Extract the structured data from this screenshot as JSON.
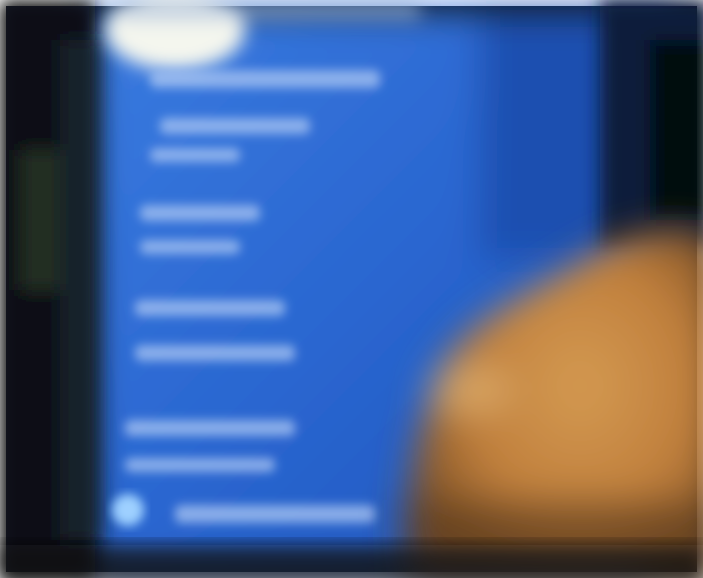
{
  "scene": {
    "description_free": true,
    "colors": {
      "frame_white": "#ffffff",
      "bezel_dark": "#0b1016",
      "bezel_edge": "#1b2730",
      "screen_blue": "#2a66d0",
      "screen_blue_light": "#3a7be0",
      "screen_blue_dark": "#1c4fb2",
      "text_blur": "#a9c6f3",
      "glare": "#f4f6ee",
      "top_dark": "#0c1a3a",
      "finger_skin": "#c98a45",
      "finger_shadow": "#8a5a2a",
      "finger_highlight": "#d9a05a",
      "bottom_dark": "#141414"
    },
    "menu_rows": [
      "blurred-line-1",
      "blurred-line-2",
      "blurred-line-3",
      "blurred-line-4",
      "blurred-line-5",
      "blurred-line-6",
      "blurred-line-7",
      "blurred-line-8"
    ]
  }
}
